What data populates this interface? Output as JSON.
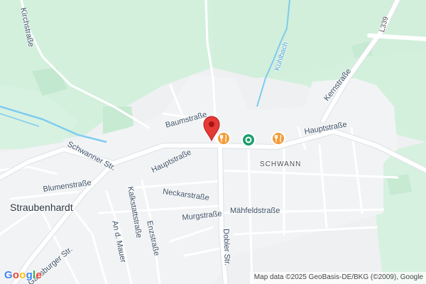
{
  "map": {
    "streets": {
      "kirchstrasse": "Kirchstraße",
      "baumstrasse": "Baumstraße",
      "hauptstrasse_west": "Hauptstraße",
      "hauptstrasse_east": "Hauptstraße",
      "kernstrasse": "Kernstraße",
      "schwanner_str": "Schwanner Str.",
      "blumenstrasse": "Blumenstraße",
      "kalkstattstrasse": "Kalkstattstraße",
      "neckarstrasse": "Neckarstraße",
      "murgstrasse": "Murgstraße",
      "maehfeldstrasse": "Mähfeldstraße",
      "an_d_mauer": "An d. Mauer",
      "enzstrasse": "Enzstraße",
      "dobler_str": "Dobler Str.",
      "gaensburger_str": "Gänsburger Str."
    },
    "water": {
      "kuehlbach": "Kühlbach"
    },
    "route_shield": "L339",
    "area_label": "SCHWANN",
    "town_label": "Straubenhardt",
    "pois": [
      {
        "name": "restaurant",
        "icon": "fork-knife-icon",
        "color": "#f29c38"
      },
      {
        "name": "place",
        "icon": "place-dot-icon",
        "color": "#1f9e6e"
      },
      {
        "name": "restaurant",
        "icon": "fork-knife-icon",
        "color": "#f29c38"
      }
    ],
    "marker": {
      "icon": "map-pin-icon",
      "color": "#e53935"
    },
    "colors": {
      "park": "#cdeedb",
      "road": "#ffffff",
      "water": "#7ecbf0",
      "block": "#f1f3f4"
    },
    "attribution": "Map data ©2025 GeoBasis-DE/BKG (©2009), Google",
    "logo": [
      "G",
      "o",
      "o",
      "g",
      "l",
      "e"
    ]
  }
}
